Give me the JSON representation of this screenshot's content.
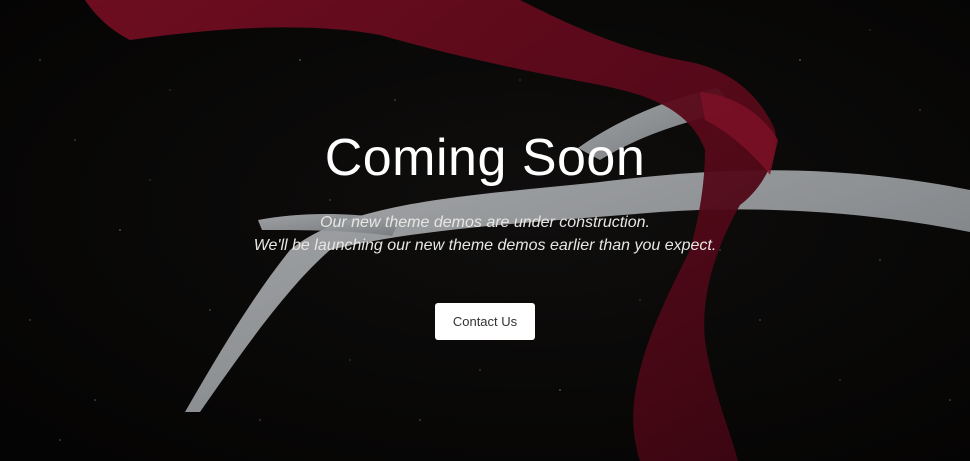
{
  "hero": {
    "title": "Coming Soon",
    "subtitle_line1": "Our new theme demos are under construction.",
    "subtitle_line2": "We'll be launching our new theme demos earlier than you expect.",
    "button_label": "Contact Us"
  },
  "colors": {
    "background": "#0a0908",
    "text": "#ffffff",
    "scarf": "#7a0f24",
    "antler": "#c9cdd1",
    "button_bg": "#ffffff",
    "button_text": "#333333"
  }
}
